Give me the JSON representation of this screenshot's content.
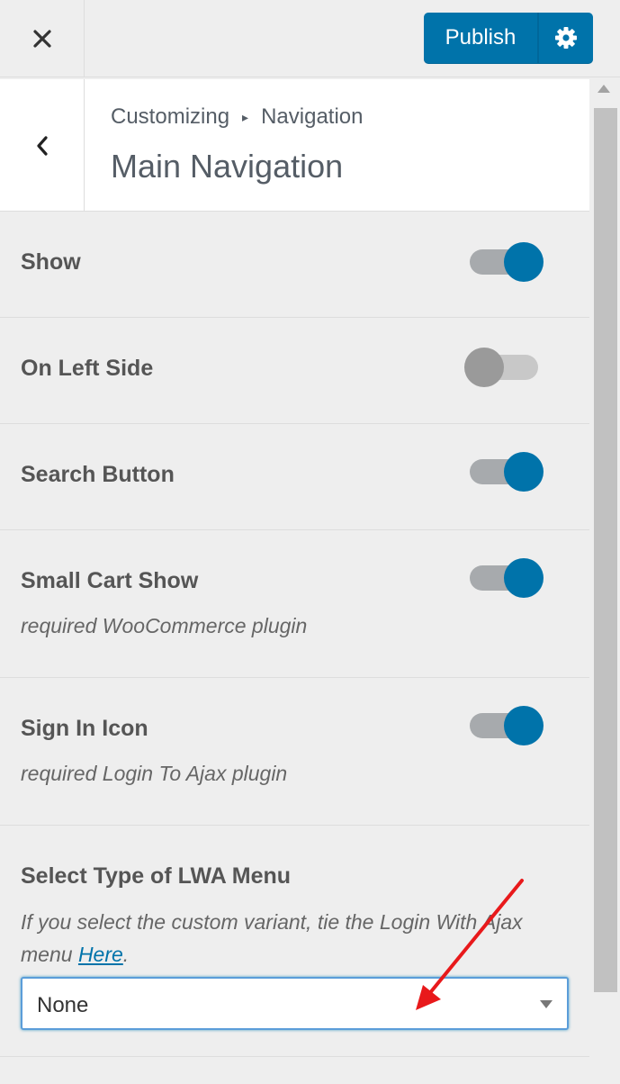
{
  "header": {
    "close_label": "Close",
    "publish_label": "Publish",
    "settings_label": "Settings"
  },
  "panel": {
    "breadcrumb_root": "Customizing",
    "breadcrumb_section": "Navigation",
    "title": "Main Navigation"
  },
  "settings": {
    "show": {
      "label": "Show",
      "enabled": true
    },
    "left_side": {
      "label": "On Left Side",
      "enabled": false
    },
    "search_button": {
      "label": "Search Button",
      "enabled": true
    },
    "small_cart": {
      "label": "Small Cart Show",
      "description": "required WooCommerce plugin",
      "enabled": true
    },
    "sign_in_icon": {
      "label": "Sign In Icon",
      "description": "required Login To Ajax plugin",
      "enabled": true
    }
  },
  "lwa_menu": {
    "label": "Select Type of LWA Menu",
    "description_before": "If you select the custom variant, tie the Login With Ajax menu ",
    "description_link": "Here",
    "description_after": ".",
    "selected": "None"
  },
  "colors": {
    "accent": "#0073aa",
    "annotation_arrow": "#e8191b"
  }
}
